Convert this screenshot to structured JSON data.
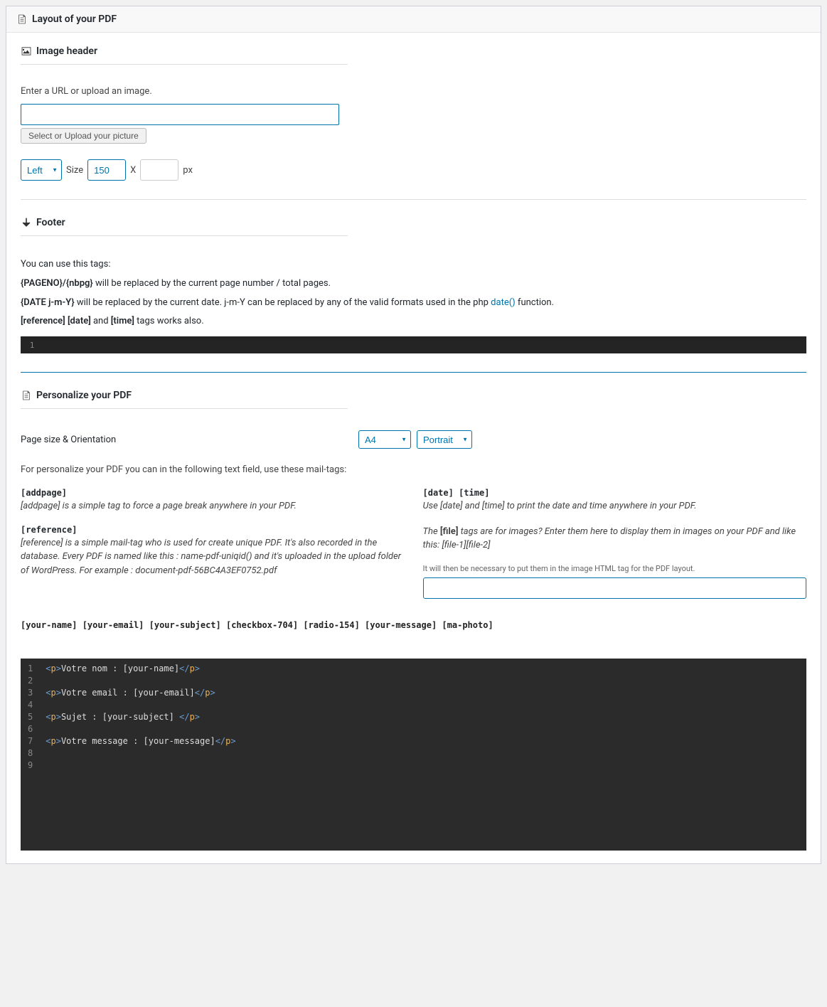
{
  "panel": {
    "title": "Layout of your PDF"
  },
  "header_section": {
    "title": "Image header",
    "url_label": "Enter a URL or upload an image.",
    "url_value": "",
    "upload_btn": "Select or Upload your picture",
    "align": "Left",
    "size_label": "Size",
    "width": "150",
    "x_label": "X",
    "height": "",
    "px_label": "px"
  },
  "footer_section": {
    "title": "Footer",
    "intro": "You can use this tags:",
    "line1_tag": "{PAGENO}/{nbpg}",
    "line1_rest": " will be replaced by the current page number / total pages.",
    "line2_tag": "{DATE j-m-Y}",
    "line2_rest": " will be replaced by the current date. j-m-Y can be replaced by any of the valid formats used in the php ",
    "line2_link": "date()",
    "line2_end": " function.",
    "line3_a": "[reference]",
    "line3_b": " [date]",
    "line3_mid": " and ",
    "line3_c": "[time]",
    "line3_end": " tags works also."
  },
  "personalize": {
    "title": "Personalize your PDF",
    "pagesize_label": "Page size & Orientation",
    "pagesize": "A4",
    "orientation": "Portrait",
    "intro": "For personalize your PDF you can in the following text field, use these mail-tags:",
    "left": {
      "addpage_tag": "[addpage]",
      "addpage_desc": "[addpage] is a simple tag to force a page break anywhere in your PDF.",
      "ref_tag": "[reference]",
      "ref_desc": "[reference] is a simple mail-tag who is used for create unique PDF. It's also recorded in the database. Every PDF is named like this : name-pdf-uniqid() and it's uploaded in the upload folder of WordPress. For example : document-pdf-56BC4A3EF0752.pdf"
    },
    "right": {
      "datetime_tag": "[date] [time]",
      "datetime_desc": "Use [date] and [time] to print the date and time anywhere in your PDF.",
      "file_pre": "The ",
      "file_tag": "[file]",
      "file_post": " tags are for images? Enter them here to display them in images on your PDF and like this: [file-1][file-2]",
      "file_note": "It will then be necessary to put them in the image HTML tag for the PDF layout.",
      "file_value": ""
    },
    "tags": "[your-name] [your-email] [your-subject] [checkbox-704] [radio-154] [your-message] [ma-photo]"
  },
  "editor": {
    "lines": [
      {
        "n": "1",
        "pre": "<p>",
        "txt": "Votre nom : [your-name]",
        "post": "</p>"
      },
      {
        "n": "2",
        "pre": "",
        "txt": "",
        "post": ""
      },
      {
        "n": "3",
        "pre": "<p>",
        "txt": "Votre email : [your-email]",
        "post": "</p>"
      },
      {
        "n": "4",
        "pre": "",
        "txt": "",
        "post": ""
      },
      {
        "n": "5",
        "pre": "<p>",
        "txt": "Sujet : [your-subject] ",
        "post": "</p>"
      },
      {
        "n": "6",
        "pre": "",
        "txt": "",
        "post": ""
      },
      {
        "n": "7",
        "pre": "<p>",
        "txt": "Votre message : [your-message]",
        "post": "</p>"
      },
      {
        "n": "8",
        "pre": "",
        "txt": "",
        "post": ""
      },
      {
        "n": "9",
        "pre": "",
        "txt": "",
        "post": ""
      }
    ]
  }
}
